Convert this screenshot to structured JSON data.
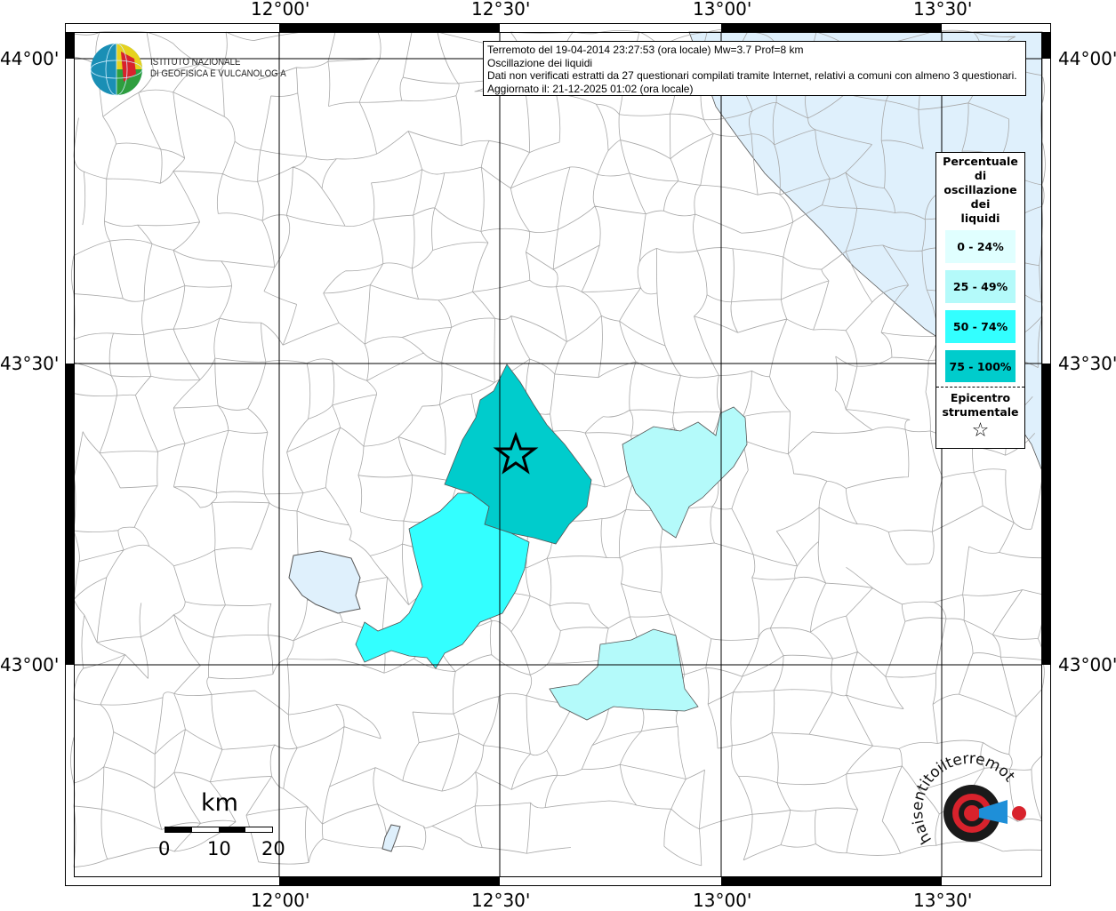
{
  "title_box": {
    "line1": "Terremoto del 19-04-2014 23:27:53 (ora locale) Mw=3.7 Prof=8 km",
    "line2": "Oscillazione dei liquidi",
    "line3": "Dati non verificati estratti da 27 questionari compilati tramite Internet, relativi a comuni con almeno 3 questionari.",
    "line4": "Aggiornato il: 21-12-2025 01:02 (ora locale)"
  },
  "logo_ingv": {
    "line1": "ISTITUTO NAZIONALE",
    "line2": "DI GEOFISICA E VULCANOLOGIA"
  },
  "logo_hsit": "www.haisentitoilterremoto.it",
  "axes": {
    "lon_ticks": [
      "12°00'",
      "12°30'",
      "13°00'",
      "13°30'"
    ],
    "lat_ticks": [
      "44°00'",
      "43°30'",
      "43°00'"
    ]
  },
  "legend": {
    "title_lines": [
      "Percentuale",
      "di",
      "oscillazione",
      "dei",
      "liquidi"
    ],
    "classes": [
      {
        "label": "0 - 24%",
        "color": "#e0ffff"
      },
      {
        "label": "25 - 49%",
        "color": "#b4fafa"
      },
      {
        "label": "50 - 74%",
        "color": "#33ffff"
      },
      {
        "label": "75 - 100%",
        "color": "#00cccc"
      }
    ],
    "epicenter_lines": [
      "Epicentro",
      "strumentale"
    ],
    "epicenter_icon": "star-outline"
  },
  "scale_bar": {
    "unit": "km",
    "labels": [
      "0",
      "10",
      "20"
    ]
  },
  "colors": {
    "sea": "#dff0fc",
    "lake": "#dff0fc",
    "boundary": "#a0a0a0"
  }
}
